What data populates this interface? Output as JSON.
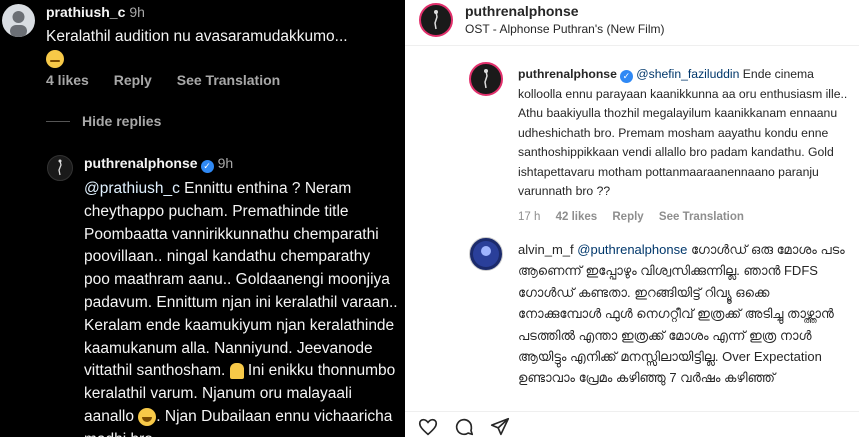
{
  "left": {
    "comment1": {
      "username": "prathiush_c",
      "time": "9h",
      "text": "Keralathil audition nu avasaramudakkumo...",
      "likes": "4 likes",
      "reply": "Reply",
      "translate": "See Translation"
    },
    "hide_replies": "Hide replies",
    "reply1": {
      "username": "puthrenalphonse",
      "time": "9h",
      "mention": "@prathiush_c",
      "text_a": " Ennittu enthina ? Neram cheythappo pucham. Premathinde title Poombaatta vannirikkunnathu chemparathi poovillaan.. ningal kandathu chemparathy poo maathram aanu.. Goldaanengi moonjiya padavum. Ennittum njan ini keralathil varaan.. Keralam ende kaamukiyum njan keralathinde kaamukanum alla. Nanniyund. Jeevanode vittathil santhosham. ",
      "text_b": " Ini enikku thonnumbo keralathil varum. Njanum oru malayaali aanallo ",
      "text_c": ". Njan Dubailaan ennu vichaaricha madhi bro."
    }
  },
  "right": {
    "post": {
      "username": "puthrenalphonse",
      "subtitle": "OST - Alphonse Puthran's (New Film)"
    },
    "comment1": {
      "username": "puthrenalphonse",
      "mention": "@shefin_faziluddin",
      "text": " Ende cinema kolloolla ennu parayaan kaanikkunna aa oru enthusiasm ille.. Athu baakiyulla thozhil megalayilum kaanikkanam ennaanu udheshichath bro. Premam mosham aayathu kondu enne santhoshippikkaan vendi allallo bro padam kandathu. Gold ishtapettavaru motham pottanmaaraanennaano paranju varunnath bro ??",
      "time": "17 h",
      "likes": "42 likes",
      "reply": "Reply",
      "translate": "See Translation"
    },
    "comment2": {
      "username": "alvin_m_f",
      "mention": "@puthrenalphonse",
      "text": " ഗോൾഡ് ഒരു മോശം പടം ആണെന്ന് ഇപ്പോഴും വിശ്വസിക്കുന്നില്ല. ഞാൻ FDFS ഗോൾഡ് കണ്ടതാ. ഇറങ്ങിയിട്ട് റിവ്യൂ ഒക്കെ നോക്കുമ്പോൾ ഫുൾ നെഗറ്റീവ് ഇത്രക്ക് അടിച്ചു താഴ്ത്താൻ പടത്തിൽ എന്താ ഇത്രക്ക് മോശം എന്ന് ഇത്ര നാൾ ആയിട്ടും എനിക്ക് മനസ്സിലായിട്ടില്ല. Over Expectation ഉണ്ടാവാം പ്രേമം കഴിഞ്ഞു 7 വർഷം കഴിഞ്ഞ്"
    },
    "actions": [
      "heart-icon",
      "comment-icon",
      "share-icon"
    ]
  }
}
